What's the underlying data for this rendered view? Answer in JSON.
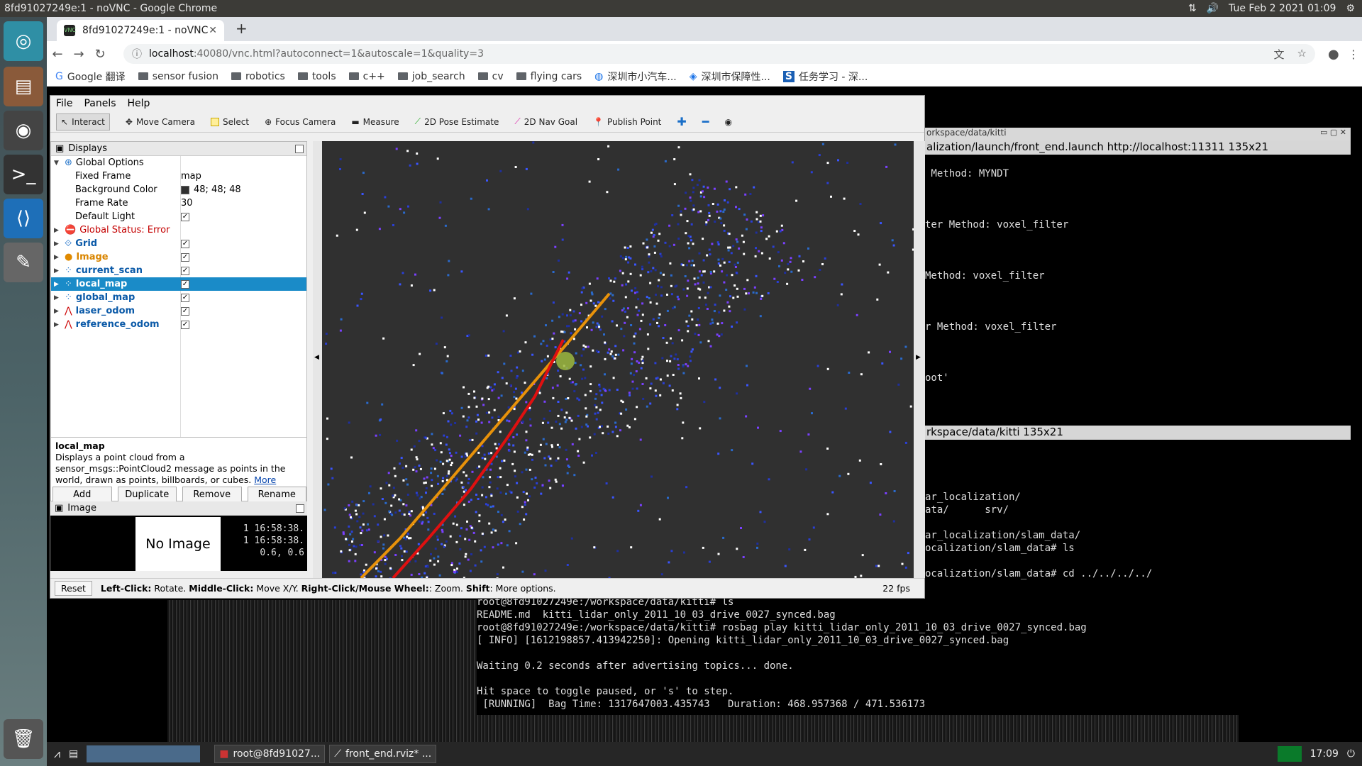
{
  "os_topbar": {
    "window_title": "8fd91027249e:1 - noVNC - Google Chrome",
    "datetime": "Tue Feb  2 2021 01:09"
  },
  "chrome": {
    "tab_title": "8fd91027249e:1 - noVNC",
    "url_host": "localhost",
    "url_rest": ":40080/vnc.html?autoconnect=1&autoscale=1&quality=3",
    "bookmarks": [
      "Google 翻译",
      "sensor fusion",
      "robotics",
      "tools",
      "c++",
      "job_search",
      "cv",
      "flying cars",
      "深圳市小汽车...",
      "深圳市保障性...",
      "任务学习 - 深..."
    ]
  },
  "rviz": {
    "menu": [
      "File",
      "Panels",
      "Help"
    ],
    "tools": [
      "Interact",
      "Move Camera",
      "Select",
      "Focus Camera",
      "Measure",
      "2D Pose Estimate",
      "2D Nav Goal",
      "Publish Point"
    ],
    "displays_title": "Displays",
    "tree": {
      "global_options": "Global Options",
      "fixed_frame_label": "Fixed Frame",
      "fixed_frame": "map",
      "bg_label": "Background Color",
      "bg_value": "48; 48; 48",
      "rate_label": "Frame Rate",
      "rate_value": "30",
      "light_label": "Default Light",
      "global_status": "Global Status: Error",
      "grid": "Grid",
      "image": "Image",
      "current_scan": "current_scan",
      "local_map": "local_map",
      "global_map": "global_map",
      "laser_odom": "laser_odom",
      "reference_odom": "reference_odom"
    },
    "desc_title": "local_map",
    "desc_text": "Displays a point cloud from a sensor_msgs::PointCloud2 message as points in the world, drawn as points, billboards, or cubes. ",
    "desc_more": "More",
    "buttons": [
      "Add",
      "Duplicate",
      "Remove",
      "Rename"
    ],
    "image_panel_title": "Image",
    "no_image": "No Image",
    "image_times": [
      "1 16:58:38.",
      "1 16:58:38.",
      "0.6, 0.6"
    ],
    "status": {
      "reset": "Reset",
      "hint_b1": "Left-Click:",
      "hint_t1": " Rotate. ",
      "hint_b2": "Middle-Click:",
      "hint_t2": " Move X/Y. ",
      "hint_b3": "Right-Click/Mouse Wheel:",
      "hint_t3": ": Zoom. ",
      "hint_b4": "Shift",
      "hint_t4": ": More options.",
      "fps": "22 fps"
    }
  },
  "terminal1": {
    "header": "orkspace/data/kitti",
    "title": "alization/launch/front_end.launch http://localhost:11311 135x21",
    "lines": [
      "",
      " Method: MYNDT",
      "",
      "",
      "",
      "ter Method: voxel_filter",
      "",
      "",
      "",
      "Method: voxel_filter",
      "",
      "",
      "",
      "r Method: voxel_filter",
      "",
      "",
      "",
      "oot'"
    ]
  },
  "terminal2": {
    "title": "rkspace/data/kitti 135x21",
    "lines": [
      "",
      "",
      "",
      "",
      "ar_localization/",
      "ata/      srv/",
      "",
      "ar_localization/slam_data/",
      "ocalization/slam_data# ls",
      "",
      "ocalization/slam_data# cd ../../../../"
    ]
  },
  "terminal3": {
    "lines": [
      "root@8fd91027249e:/workspace/data/kitti# ls",
      "README.md  kitti_lidar_only_2011_10_03_drive_0027_synced.bag",
      "root@8fd91027249e:/workspace/data/kitti# rosbag play kitti_lidar_only_2011_10_03_drive_0027_synced.bag",
      "[ INFO] [1612198857.413942250]: Opening kitti_lidar_only_2011_10_03_drive_0027_synced.bag",
      "",
      "Waiting 0.2 seconds after advertising topics... done.",
      "",
      "Hit space to toggle paused, or 's' to step.",
      " [RUNNING]  Bag Time: 1317647003.435743   Duration: 468.957368 / 471.536173"
    ]
  },
  "taskbar": {
    "task1": "root@8fd91027...",
    "task2": "front_end.rviz* ...",
    "clock": "17:09"
  }
}
